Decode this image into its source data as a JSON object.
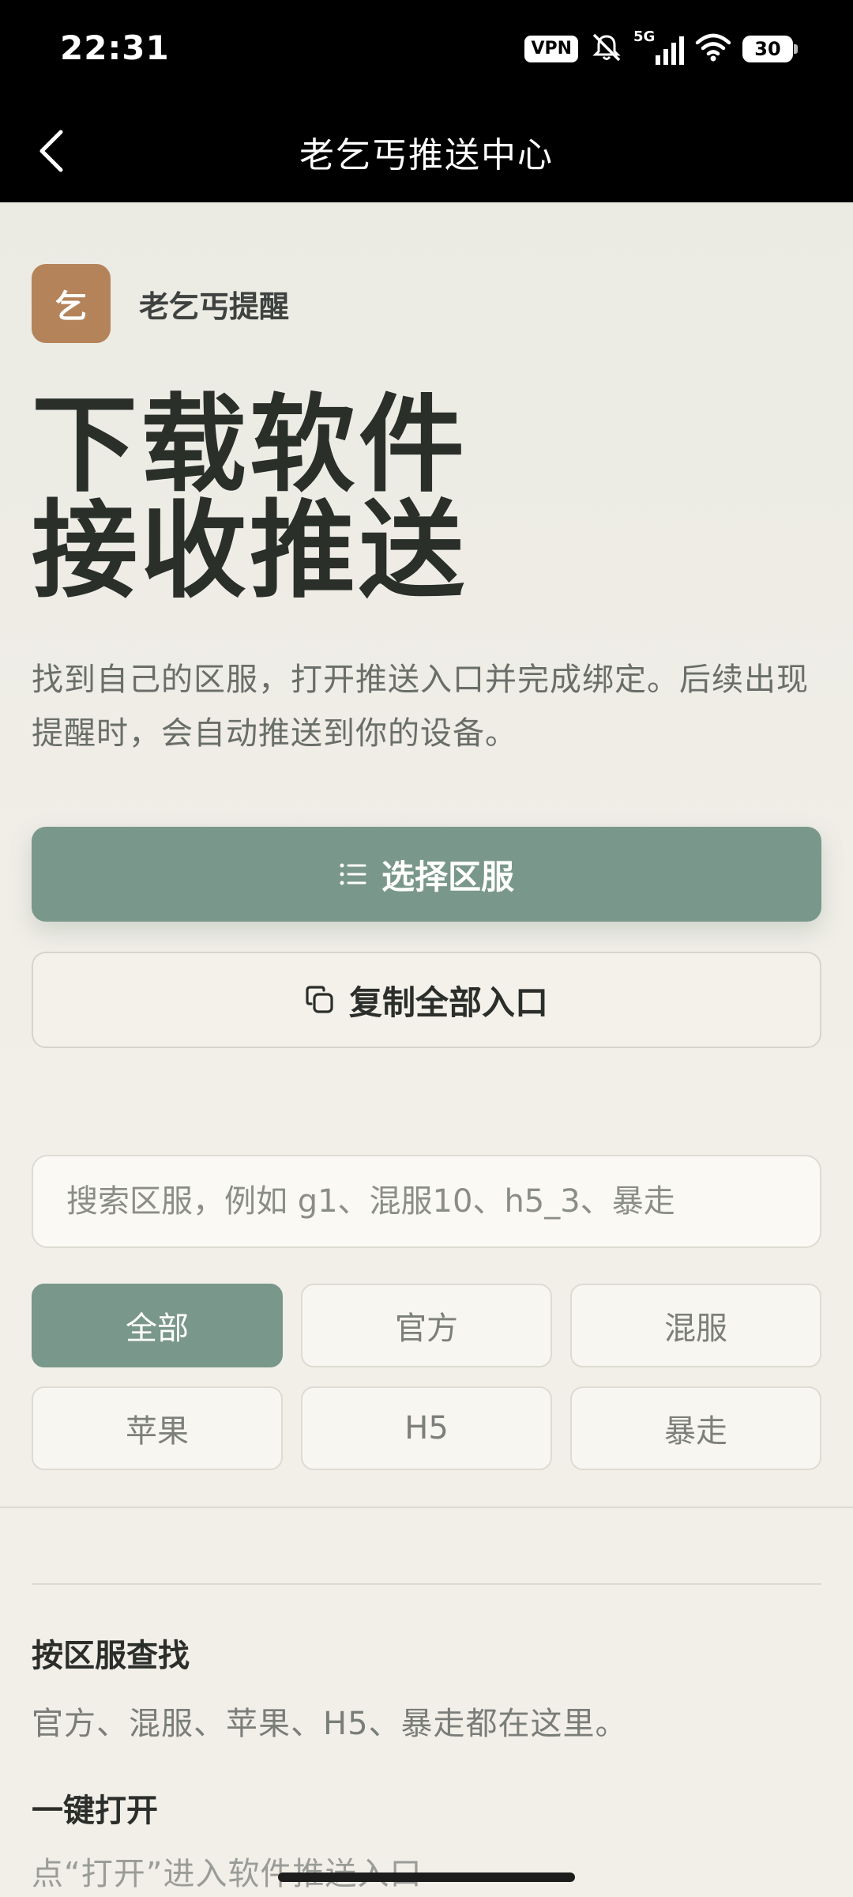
{
  "status_bar": {
    "time": "22:31",
    "vpn_label": "VPN",
    "network_label": "5G",
    "battery_level": "30"
  },
  "nav": {
    "title": "老乞丐推送中心",
    "back_icon": "chevron-left-icon"
  },
  "brand": {
    "logo_char": "乞",
    "logo_color": "#b5835a",
    "name": "老乞丐提醒"
  },
  "hero": {
    "title_line1": "下载软件",
    "title_line2": "接收推送",
    "description": "找到自己的区服，打开推送入口并完成绑定。后续出现提醒时，会自动推送到你的设备。"
  },
  "actions": {
    "primary_label": "选择区服",
    "primary_icon": "list-icon",
    "secondary_label": "复制全部入口",
    "secondary_icon": "copy-icon"
  },
  "search": {
    "placeholder": "搜索区服，例如 g1、混服10、h5_3、暴走",
    "value": ""
  },
  "filters": {
    "selected": "全部",
    "items": [
      "全部",
      "官方",
      "混服",
      "苹果",
      "H5",
      "暴走"
    ]
  },
  "info": {
    "heading1": "按区服查找",
    "text1": "官方、混服、苹果、H5、暴走都在这里。",
    "heading2": "一键打开",
    "text2": "点“打开”进入软件推送入口"
  },
  "colors": {
    "accent": "#79978a",
    "background": "#f2efe8",
    "header": "#000000"
  }
}
